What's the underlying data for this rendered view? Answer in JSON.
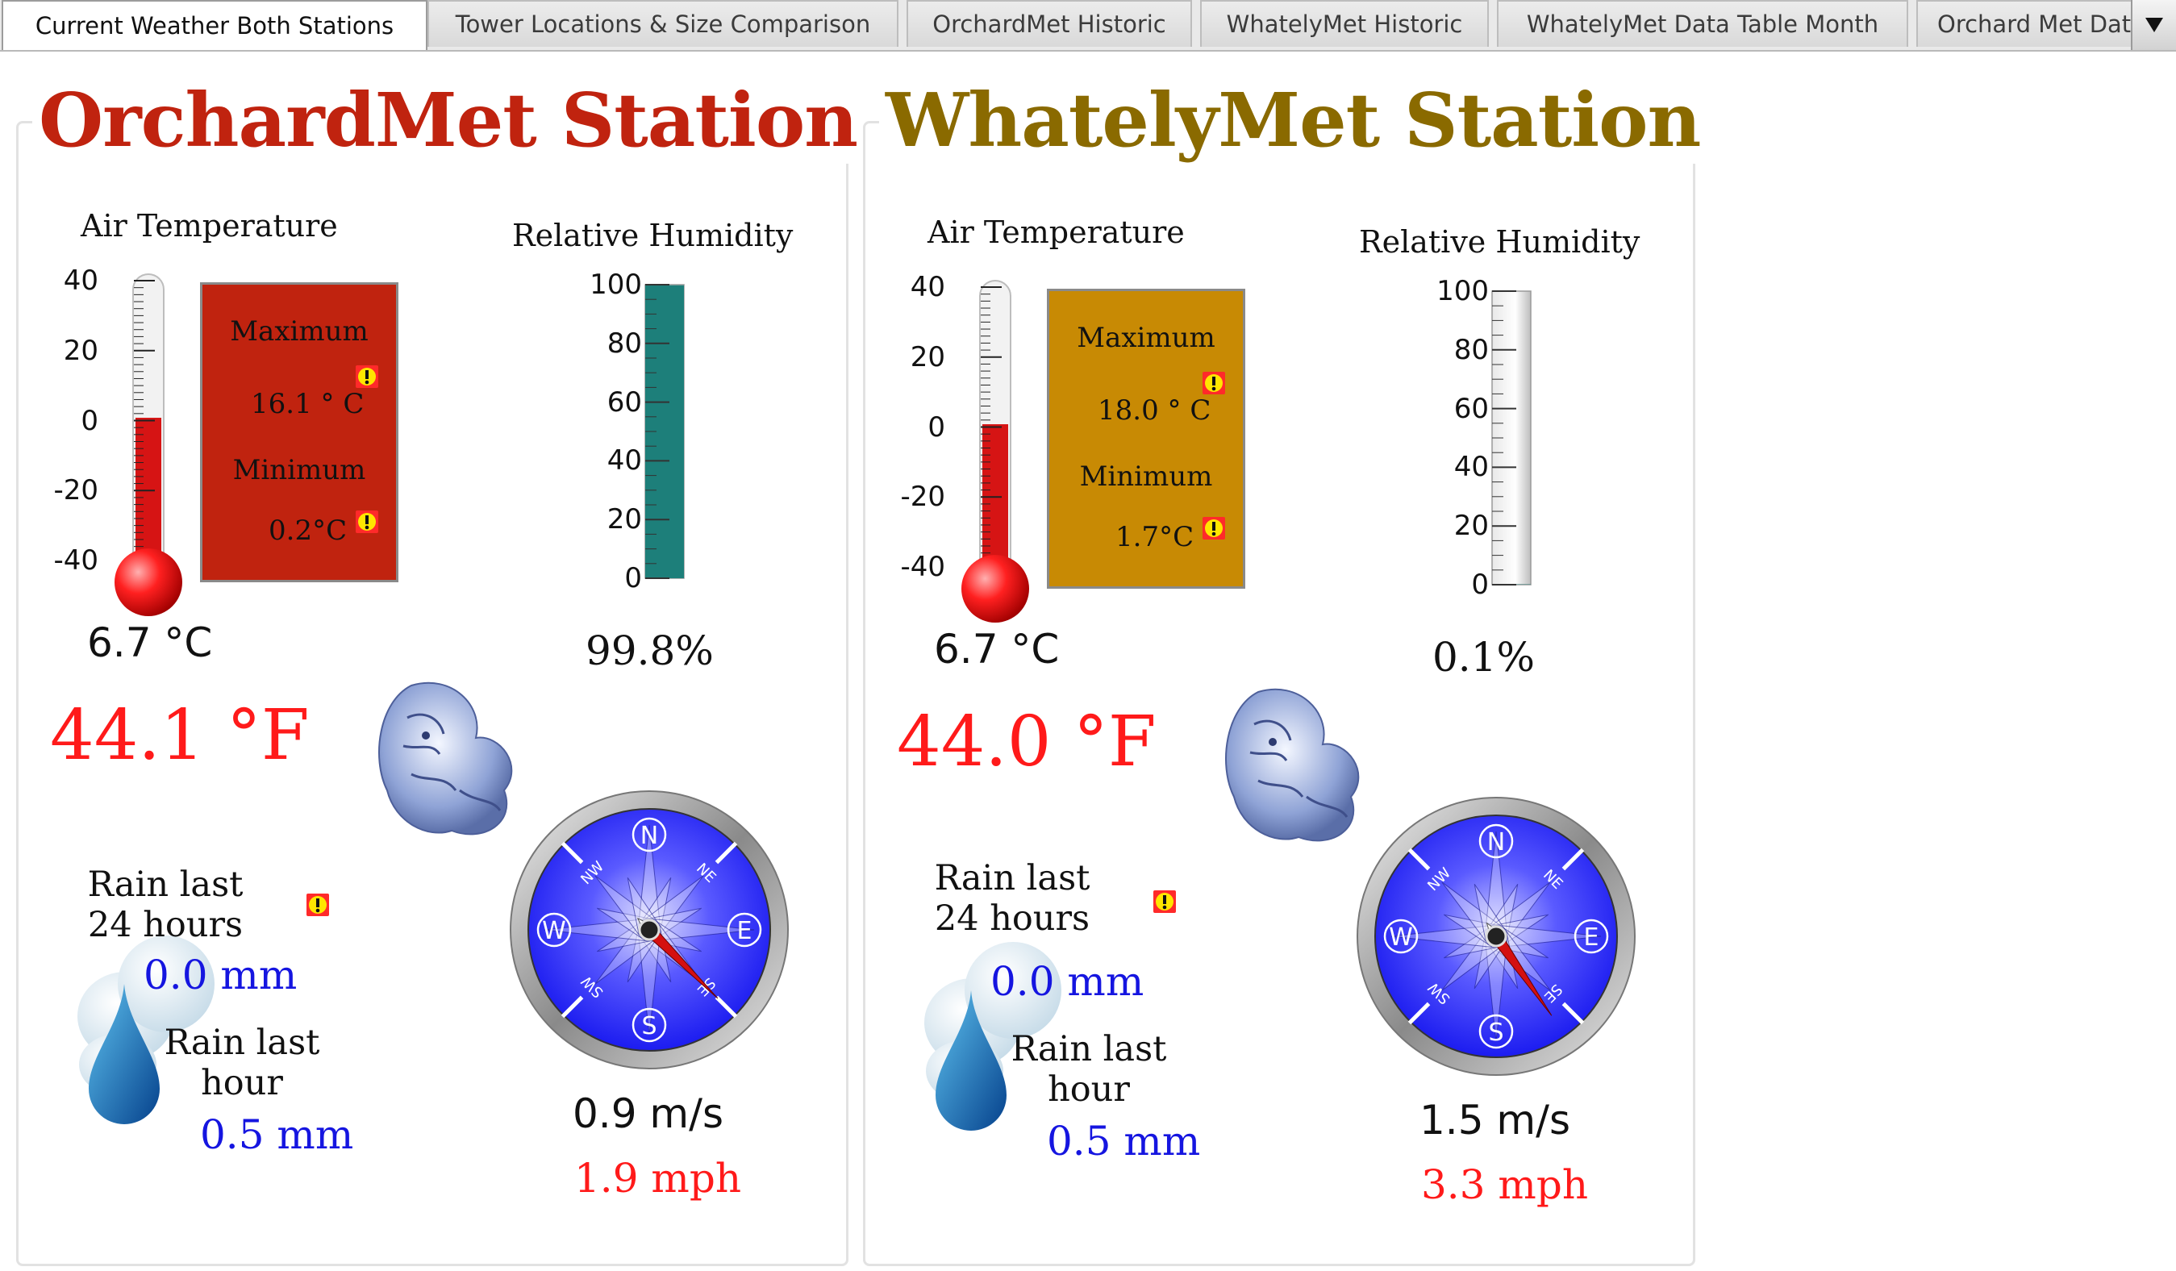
{
  "tabs": [
    {
      "label": "Current Weather Both Stations",
      "active": true
    },
    {
      "label": "Tower Locations & Size Comparison",
      "active": false
    },
    {
      "label": "OrchardMet Historic",
      "active": false
    },
    {
      "label": "WhatelyMet Historic",
      "active": false
    },
    {
      "label": "WhatelyMet Data Table Month",
      "active": false
    },
    {
      "label": "Orchard Met Dat",
      "active": false
    }
  ],
  "tab_scroll_icon": "chevron-down-icon",
  "stations": [
    {
      "title": "OrchardMet Station",
      "title_color": "#c0230f",
      "air_temp_label": "Air Temperature",
      "thermo_scale": [
        "40",
        "20",
        "0",
        "-20",
        "-40"
      ],
      "thermo_fill_level": 0.51,
      "max_label": "Maximum",
      "max_value": "16.1 ° C",
      "min_label": "Minimum",
      "min_value": "0.2°C",
      "box_color": "#c0230f",
      "humidity_label": "Relative Humidity",
      "humidity_scale": [
        "100",
        "80",
        "60",
        "40",
        "20",
        "0"
      ],
      "humidity_level": 0.998,
      "humidity_fill_color": "#1d7f7a",
      "temp_c": "6.7 °C",
      "temp_f": "44.1 °F",
      "humidity_value": "99.8%",
      "rain24_label": "Rain last 24 hours",
      "rain24_value": "0.0 mm",
      "rain1_label": "Rain last hour",
      "rain1_value": "0.5 mm",
      "wind_ms": "0.9 m/s",
      "wind_mph": "1.9 mph",
      "compass_labels": [
        "N",
        "E",
        "S",
        "W",
        "NE",
        "SE",
        "SW",
        "NW"
      ],
      "wind_direction_deg": 135
    },
    {
      "title": "WhatelyMet Station",
      "title_color": "#8a6a00",
      "air_temp_label": "Air Temperature",
      "thermo_scale": [
        "40",
        "20",
        "0",
        "-20",
        "-40"
      ],
      "thermo_fill_level": 0.51,
      "max_label": "Maximum",
      "max_value": "18.0 ° C",
      "min_label": "Minimum",
      "min_value": "1.7°C",
      "box_color": "#c88a04",
      "humidity_label": "Relative Humidity",
      "humidity_scale": [
        "100",
        "80",
        "60",
        "40",
        "20",
        "0"
      ],
      "humidity_level": 0.001,
      "humidity_fill_color": "#1d7f7a",
      "temp_c": "6.7 °C",
      "temp_f": "44.0 °F",
      "humidity_value": "0.1%",
      "rain24_label": "Rain last 24 hours",
      "rain24_value": "0.0 mm",
      "rain1_label": "Rain last hour",
      "rain1_value": "0.5 mm",
      "wind_ms": "1.5 m/s",
      "wind_mph": "3.3 mph",
      "compass_labels": [
        "N",
        "E",
        "S",
        "W",
        "NE",
        "SE",
        "SW",
        "NW"
      ],
      "wind_direction_deg": 145
    }
  ]
}
